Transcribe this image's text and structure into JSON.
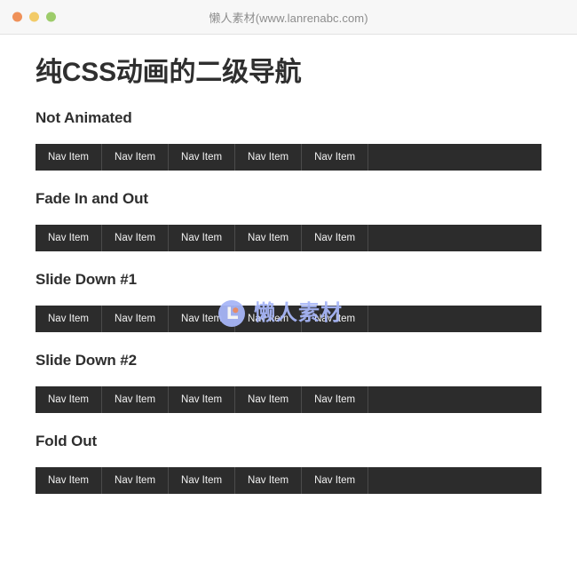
{
  "chrome": {
    "title": "懒人素材(www.lanrenabc.com)",
    "buttons": {
      "close": "close-button",
      "minimize": "minimize-button",
      "maximize": "maximize-button"
    },
    "colors": {
      "close": "#ef9159",
      "minimize": "#f2cb68",
      "maximize": "#9dcc6a",
      "bar_background": "#f7f7f7"
    }
  },
  "page": {
    "title": "纯CSS动画的二级导航",
    "background": "#ffffff",
    "text_color": "#2f2f2f",
    "nav_background": "#2c2c2c",
    "nav_divider": "#4b4b4b",
    "nav_text_color": "#f2f2f2",
    "sections": [
      {
        "heading": "Not Animated",
        "nav_items": [
          "Nav Item",
          "Nav Item",
          "Nav Item",
          "Nav Item",
          "Nav Item"
        ]
      },
      {
        "heading": "Fade In and Out",
        "nav_items": [
          "Nav Item",
          "Nav Item",
          "Nav Item",
          "Nav Item",
          "Nav Item"
        ]
      },
      {
        "heading": "Slide Down #1",
        "nav_items": [
          "Nav Item",
          "Nav Item",
          "Nav Item",
          "Nav Item",
          "Nav Item"
        ]
      },
      {
        "heading": "Slide Down #2",
        "nav_items": [
          "Nav Item",
          "Nav Item",
          "Nav Item",
          "Nav Item",
          "Nav Item"
        ]
      },
      {
        "heading": "Fold Out",
        "nav_items": [
          "Nav Item",
          "Nav Item",
          "Nav Item",
          "Nav Item",
          "Nav Item"
        ]
      }
    ]
  },
  "watermark": {
    "text": "懒人素材",
    "icon": "lanrenabc-logo-icon",
    "color": "#a7b6f7",
    "accent_color": "#f0906a"
  }
}
